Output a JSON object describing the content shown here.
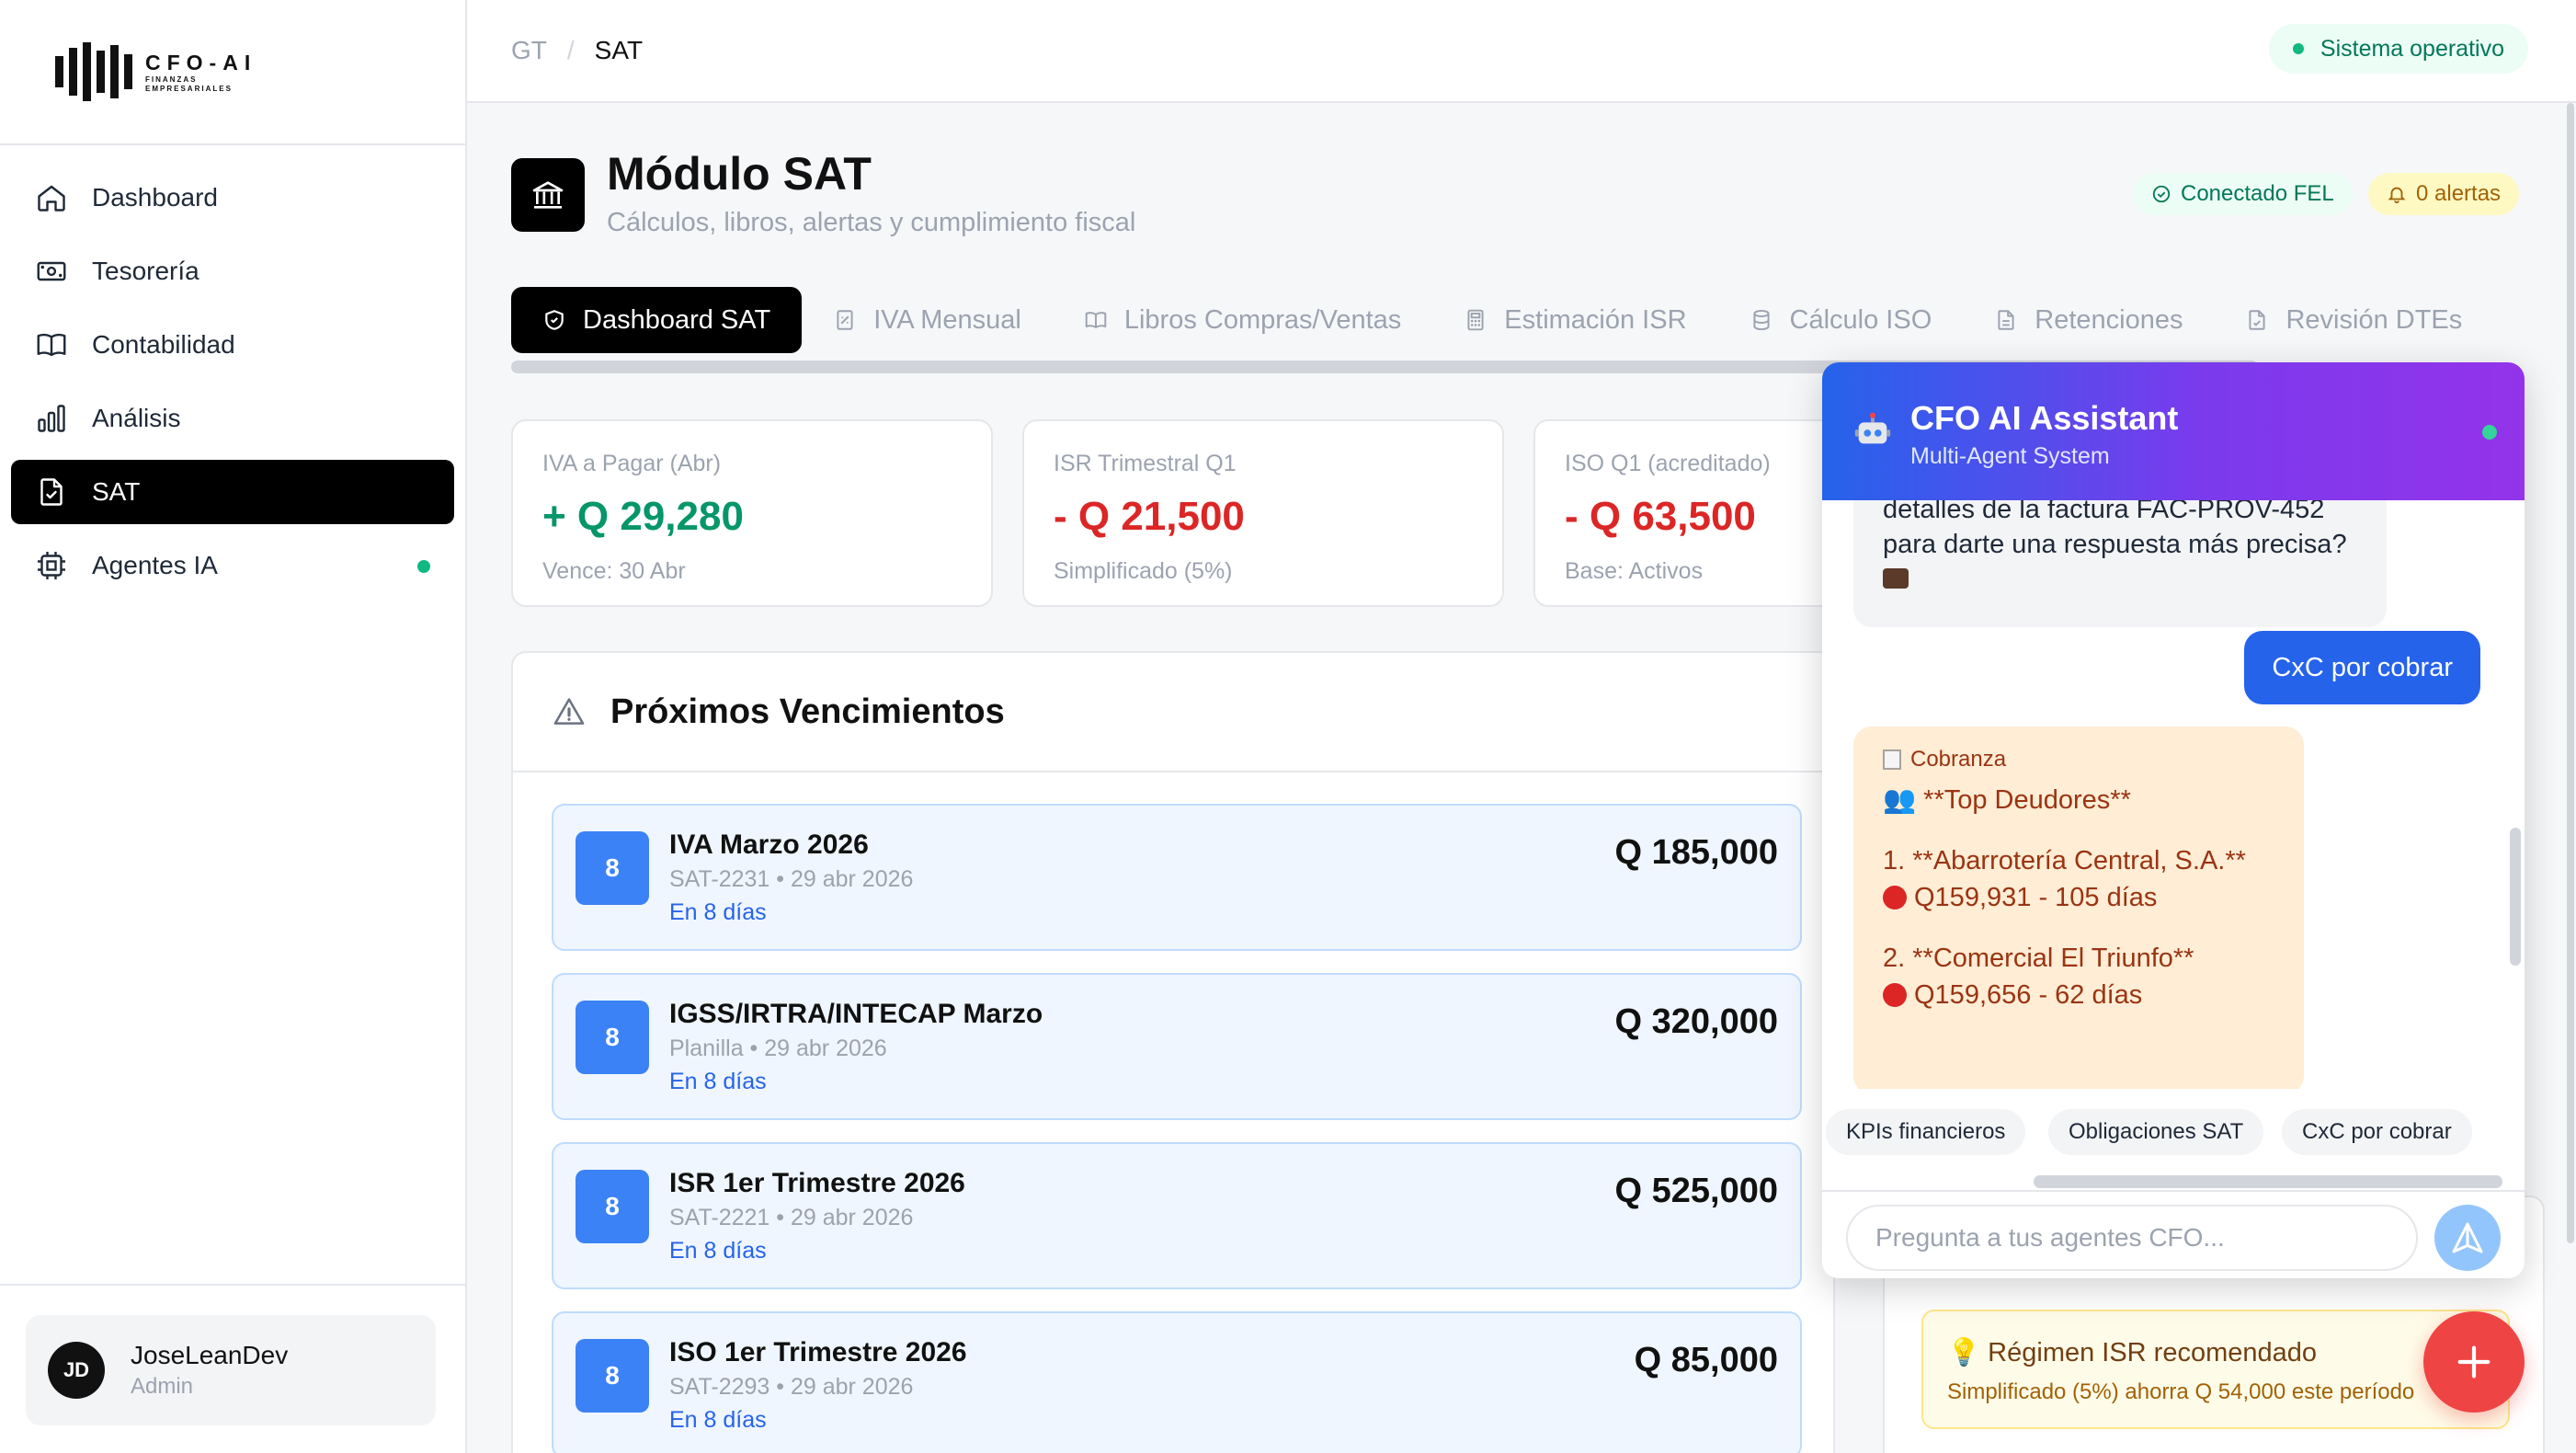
{
  "brand": {
    "name": "CFO-AI",
    "tagline_1": "FINANZAS",
    "tagline_2": "EMPRESARIALES"
  },
  "sidebar": {
    "items": [
      {
        "label": "Dashboard",
        "icon": "home-icon"
      },
      {
        "label": "Tesorería",
        "icon": "banknote-icon"
      },
      {
        "label": "Contabilidad",
        "icon": "book-icon"
      },
      {
        "label": "Análisis",
        "icon": "bar-chart-icon"
      },
      {
        "label": "SAT",
        "icon": "file-check-icon",
        "active": true
      },
      {
        "label": "Agentes IA",
        "icon": "chip-icon"
      }
    ],
    "user": {
      "initials": "JD",
      "name": "JoseLeanDev",
      "role": "Admin"
    }
  },
  "topbar": {
    "breadcrumb": [
      "GT",
      "/",
      "SAT"
    ],
    "status": "Sistema operativo"
  },
  "header": {
    "title": "Módulo SAT",
    "subtitle": "Cálculos, libros, alertas y cumplimiento fiscal",
    "fel_status": "Conectado FEL",
    "alerts": "0 alertas"
  },
  "tabs": [
    {
      "label": "Dashboard SAT",
      "icon": "shield-icon"
    },
    {
      "label": "IVA Mensual",
      "icon": "receipt-icon"
    },
    {
      "label": "Libros Compras/Ventas",
      "icon": "book-icon"
    },
    {
      "label": "Estimación ISR",
      "icon": "calculator-icon"
    },
    {
      "label": "Cálculo ISO",
      "icon": "database-icon"
    },
    {
      "label": "Retenciones",
      "icon": "document-icon"
    },
    {
      "label": "Revisión DTEs",
      "icon": "document-check-icon"
    }
  ],
  "stats": [
    {
      "label": "IVA a Pagar (Abr)",
      "value": "+ Q 29,280",
      "sub": "Vence: 30 Abr",
      "tone": "positive"
    },
    {
      "label": "ISR Trimestral Q1",
      "value": "- Q 21,500",
      "sub": "Simplificado (5%)",
      "tone": "negative"
    },
    {
      "label": "ISO Q1 (acreditado)",
      "value": "- Q 63,500",
      "sub": "Base: Activos",
      "tone": "negative"
    }
  ],
  "vencimientos": {
    "title": "Próximos Vencimientos",
    "items": [
      {
        "badge": "8",
        "title": "IVA Marzo 2026",
        "meta": "SAT-2231 • 29 abr 2026",
        "due": "En 8 días",
        "amount": "Q 185,000"
      },
      {
        "badge": "8",
        "title": "IGSS/IRTRA/INTECAP Marzo",
        "meta": "Planilla • 29 abr 2026",
        "due": "En 8 días",
        "amount": "Q 320,000"
      },
      {
        "badge": "8",
        "title": "ISR 1er Trimestre 2026",
        "meta": "SAT-2221 • 29 abr 2026",
        "due": "En 8 días",
        "amount": "Q 525,000"
      },
      {
        "badge": "8",
        "title": "ISO 1er Trimestre 2026",
        "meta": "SAT-2293 • 29 abr 2026",
        "due": "En 8 días",
        "amount": "Q 85,000"
      }
    ]
  },
  "recommendation": {
    "title": "Régimen ISR recomendado",
    "text": "Simplificado (5%) ahorra Q 54,000 este período"
  },
  "chat": {
    "title": "CFO AI Assistant",
    "subtitle": "Multi-Agent System",
    "prev_clipped": "detalles de la factura FAC-PROV-452",
    "prev_line2": "para darte una respuesta más precisa?",
    "user_message": "CxC por cobrar",
    "agent_label": "Cobranza",
    "agent_lines": [
      "👥 **Top Deudores**",
      "1. **Abarrotería Central, S.A.**",
      "Q159,931 - 105 días",
      "2. **Comercial El Triunfo**",
      "Q159,656 - 62 días"
    ],
    "quick_actions": [
      "KPIs financieros",
      "Obligaciones SAT",
      "CxC por cobrar"
    ],
    "input_placeholder": "Pregunta a tus agentes CFO..."
  },
  "colors": {
    "accent": "#2563eb",
    "positive": "#059669",
    "negative": "#dc2626",
    "fab": "#ef4444",
    "active_nav": "#000000"
  }
}
